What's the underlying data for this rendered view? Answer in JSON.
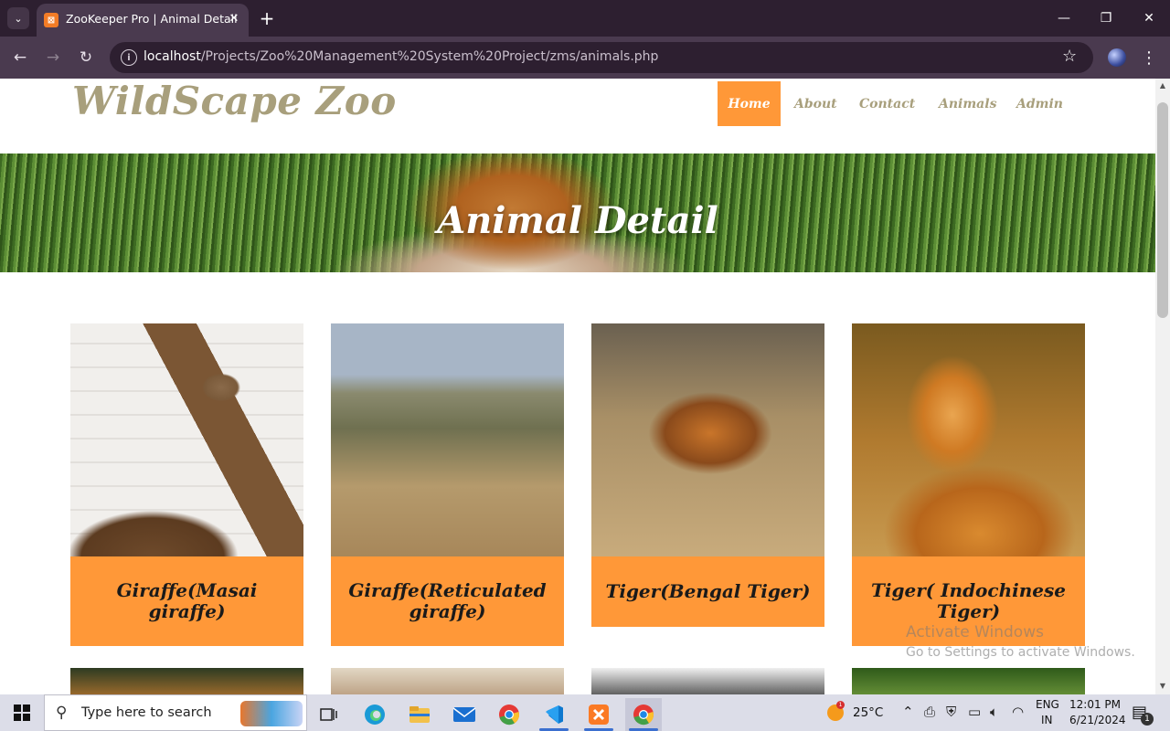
{
  "browser": {
    "tab_title": "ZooKeeper Pro | Animal Detail",
    "url_host": "localhost",
    "url_path": "/Projects/Zoo%20Management%20System%20Project/zms/animals.php"
  },
  "site": {
    "logo": "WildScape Zoo",
    "nav": [
      {
        "label": "Home",
        "active": true
      },
      {
        "label": "About",
        "active": false
      },
      {
        "label": "Contact",
        "active": false
      },
      {
        "label": "Animals",
        "active": false
      },
      {
        "label": "Admin",
        "active": false
      }
    ],
    "banner_title": "Animal Detail"
  },
  "animals": [
    {
      "name": "Giraffe(Masai giraffe)"
    },
    {
      "name": "Giraffe(Reticulated giraffe)"
    },
    {
      "name": "Tiger(Bengal Tiger)"
    },
    {
      "name": "Tiger( Indochinese Tiger)"
    }
  ],
  "watermark": {
    "line1": "Activate Windows",
    "line2": "Go to Settings to activate Windows."
  },
  "taskbar": {
    "search_placeholder": "Type here to search",
    "weather": "25°C",
    "weather_badge": "1",
    "lang_line1": "ENG",
    "lang_line2": "IN",
    "time": "12:01 PM",
    "date": "6/21/2024",
    "notifications": "1"
  }
}
